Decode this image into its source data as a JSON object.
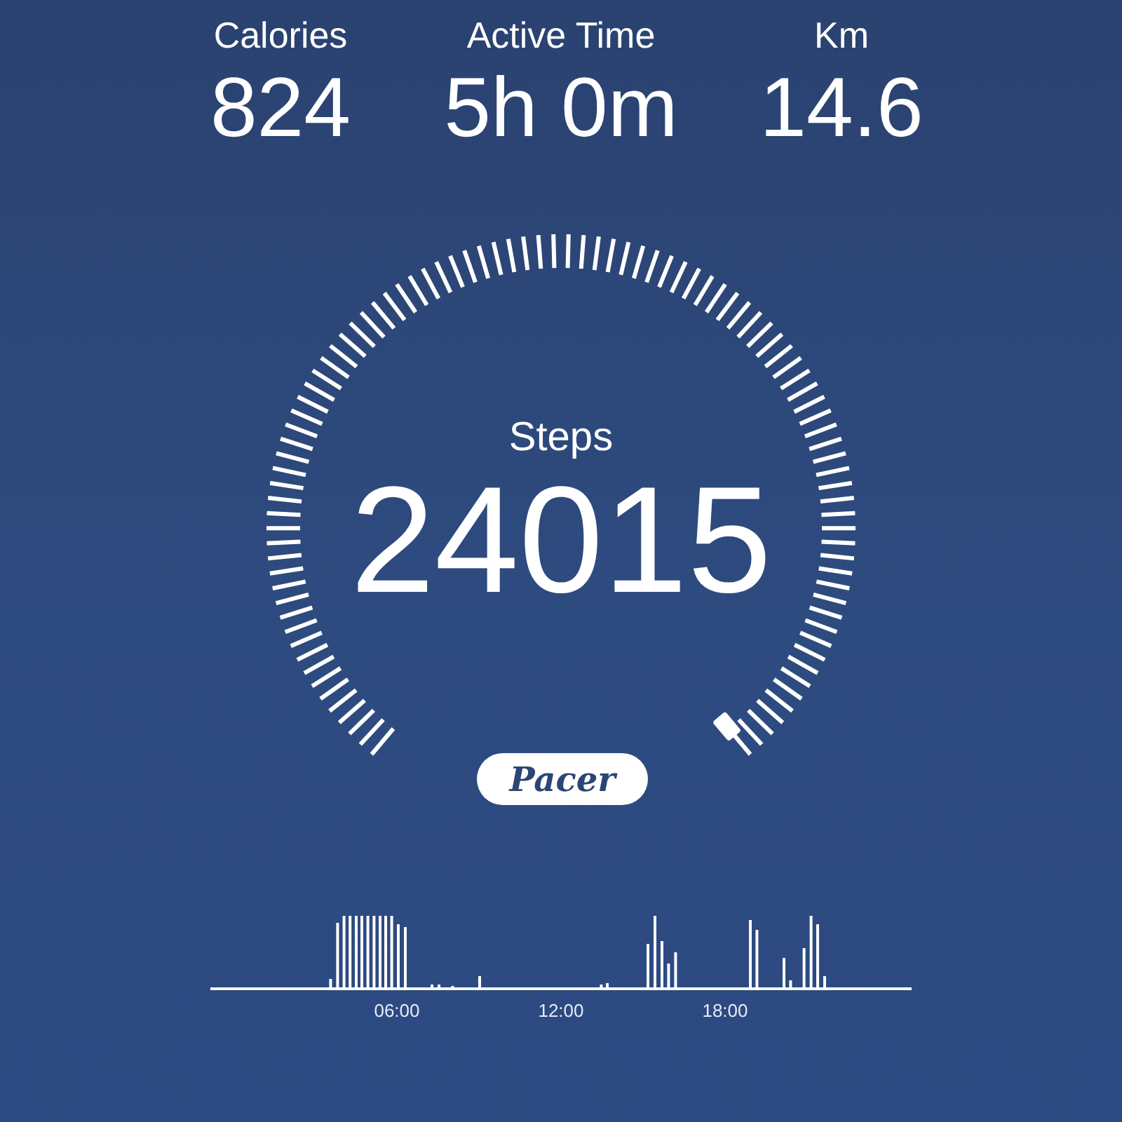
{
  "stats": [
    {
      "label": "Calories",
      "value": "824"
    },
    {
      "label": "Active Time",
      "value": "5h 0m"
    },
    {
      "label": "Km",
      "value": "14.6"
    }
  ],
  "gauge": {
    "label": "Steps",
    "value": "24015"
  },
  "badge": "Pacer",
  "activity_chart": {
    "axis_labels": [
      "06:00",
      "12:00",
      "18:00"
    ]
  }
}
